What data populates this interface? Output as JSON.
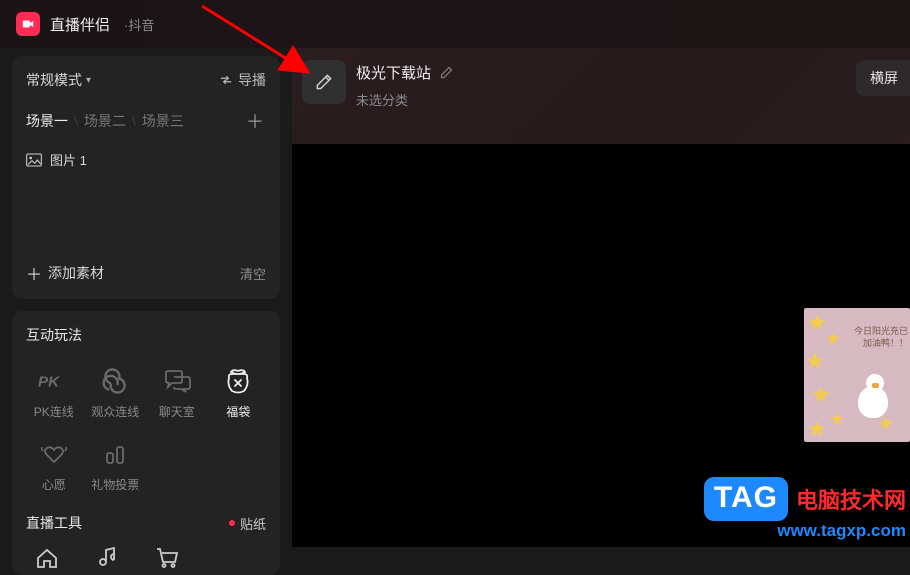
{
  "app": {
    "title": "直播伴侣",
    "subtitle": "·抖音"
  },
  "scenes_panel": {
    "mode_label": "常规模式",
    "guide_label": "导播",
    "tabs": [
      "场景一",
      "场景二",
      "场景三"
    ],
    "active_tab": 0,
    "source_item": "图片 1",
    "add_source_label": "添加素材",
    "clear_label": "清空"
  },
  "interactive_panel": {
    "title": "互动玩法",
    "items": [
      {
        "label": "PK连线",
        "icon": "pk-icon"
      },
      {
        "label": "观众连线",
        "icon": "link-icon"
      },
      {
        "label": "聊天室",
        "icon": "chat-icon"
      },
      {
        "label": "福袋",
        "icon": "bag-icon",
        "highlight": true
      },
      {
        "label": "心愿",
        "icon": "wish-icon"
      },
      {
        "label": "礼物投票",
        "icon": "vote-icon"
      }
    ]
  },
  "tools_panel": {
    "title": "直播工具",
    "sticker_label": "贴纸"
  },
  "stream": {
    "title": "极光下载站",
    "category_placeholder": "未选分类",
    "orientation_label": "横屏"
  },
  "overlay": {
    "line1": "今日阳光充已",
    "line2": "加油鸭！！"
  },
  "watermark": {
    "badge": "TAG",
    "cn": "电脑技术网",
    "url": "www.tagxp.com"
  },
  "colors": {
    "accent": "#fe2c55",
    "link": "#1e88ff"
  }
}
